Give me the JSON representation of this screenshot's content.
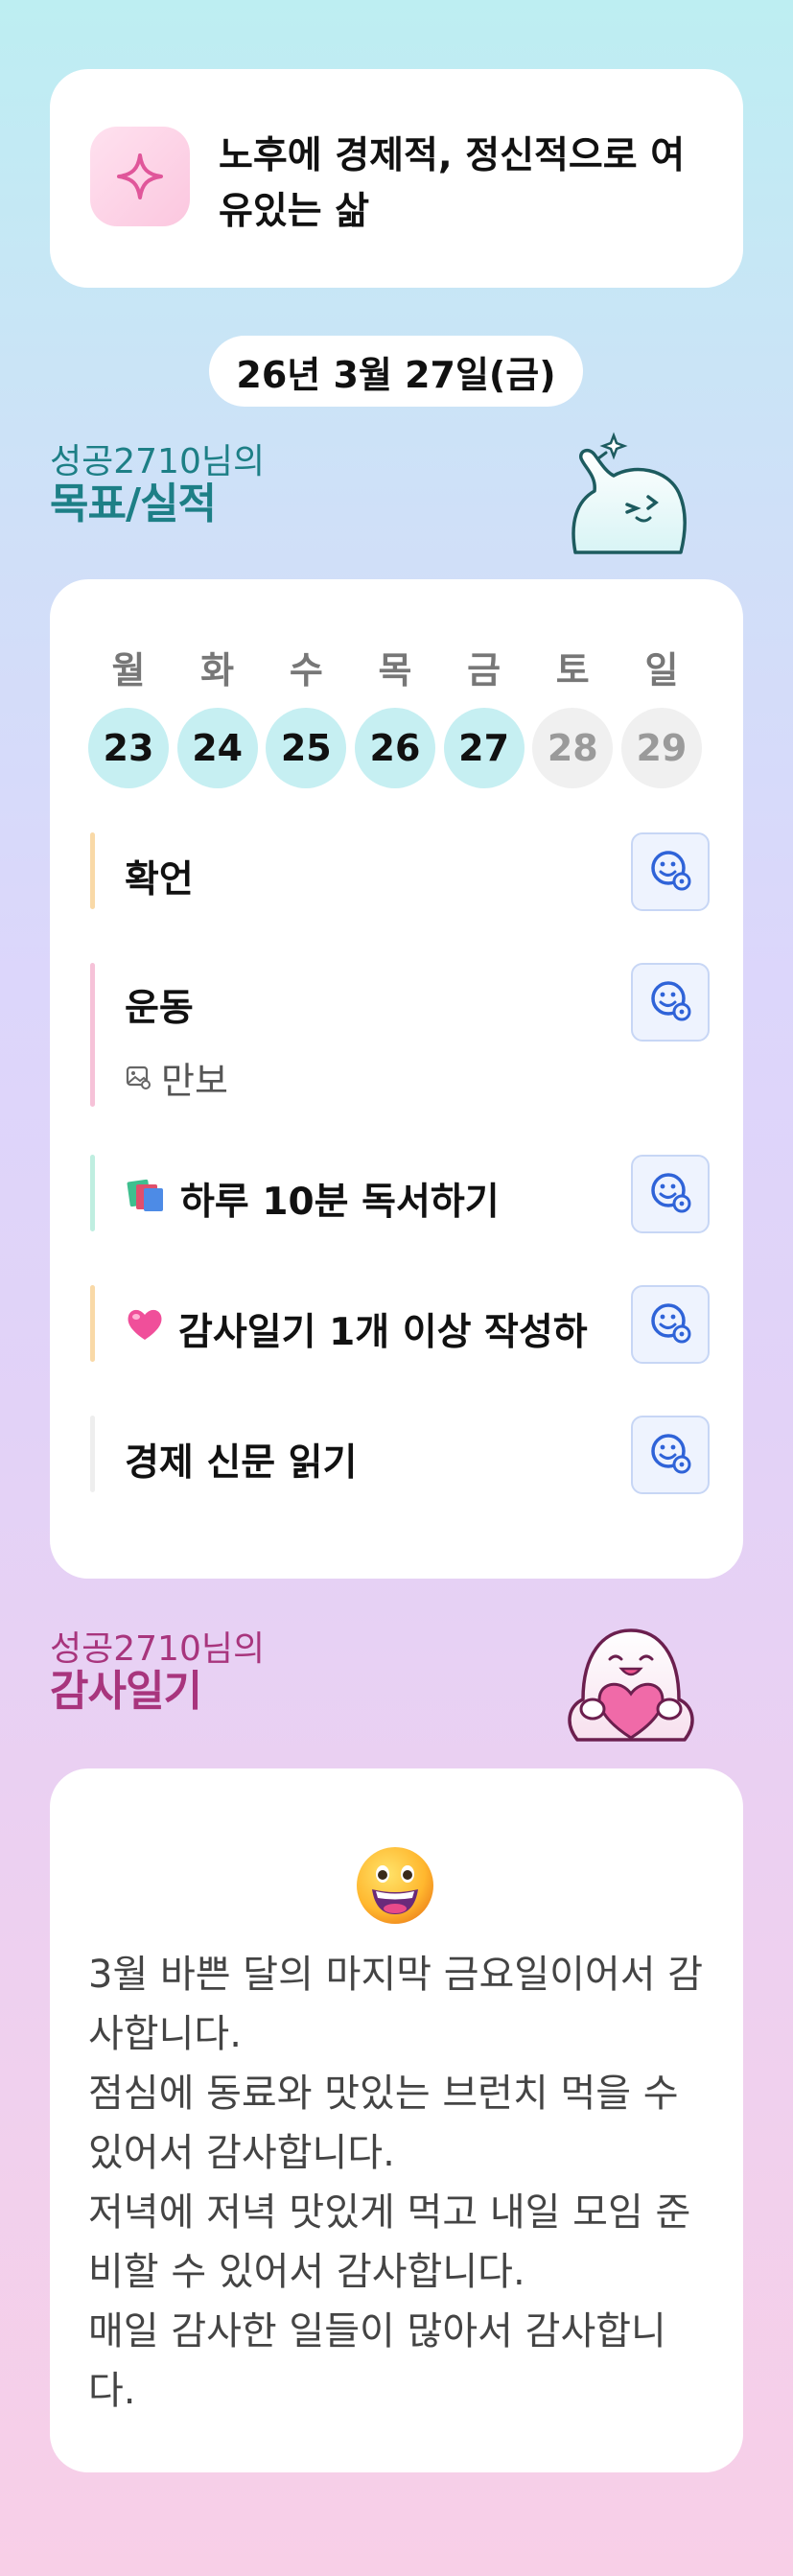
{
  "goal": {
    "text": "노후에 경제적, 정신적으로 여유있는 삶",
    "icon": "sparkle-icon"
  },
  "date": "26년 3월 27일(금)",
  "goals_section": {
    "subtitle": "성공2710님의",
    "title": "목표/실적"
  },
  "week": {
    "days": [
      "월",
      "화",
      "수",
      "목",
      "금",
      "토",
      "일"
    ],
    "dates": [
      "23",
      "24",
      "25",
      "26",
      "27",
      "28",
      "29"
    ],
    "done": [
      true,
      true,
      true,
      true,
      true,
      false,
      false
    ]
  },
  "habits": [
    {
      "label": "확언",
      "emoji": "",
      "color": "#f9d9a7"
    },
    {
      "label": "운동",
      "emoji": "",
      "color": "#f6c2d8",
      "sub": "만보",
      "sub_icon": "image-icon"
    },
    {
      "label": "하루 10분 독서하기",
      "emoji": "📚",
      "color": "#bfeee0"
    },
    {
      "label": "감사일기 1개 이상 작성하",
      "emoji": "💗",
      "color": "#f9d9a7"
    },
    {
      "label": "경제 신문 읽기",
      "emoji": "",
      "color": "#eeeeee"
    }
  ],
  "gratitude_section": {
    "subtitle": "성공2710님의",
    "title": "감사일기"
  },
  "gratitude": {
    "emoji": "grinning-face-icon",
    "text": "3월 바쁜 달의 마지막 금요일이어서 감사합니다.\n점심에 동료와 맛있는 브런치 먹을 수 있어서 감사합니다.\n저녁에 저녁 맛있게 먹고 내일 모임 준비할 수 있어서 감사합니다.\n매일 감사한 일들이 많아서 감사합니다."
  }
}
